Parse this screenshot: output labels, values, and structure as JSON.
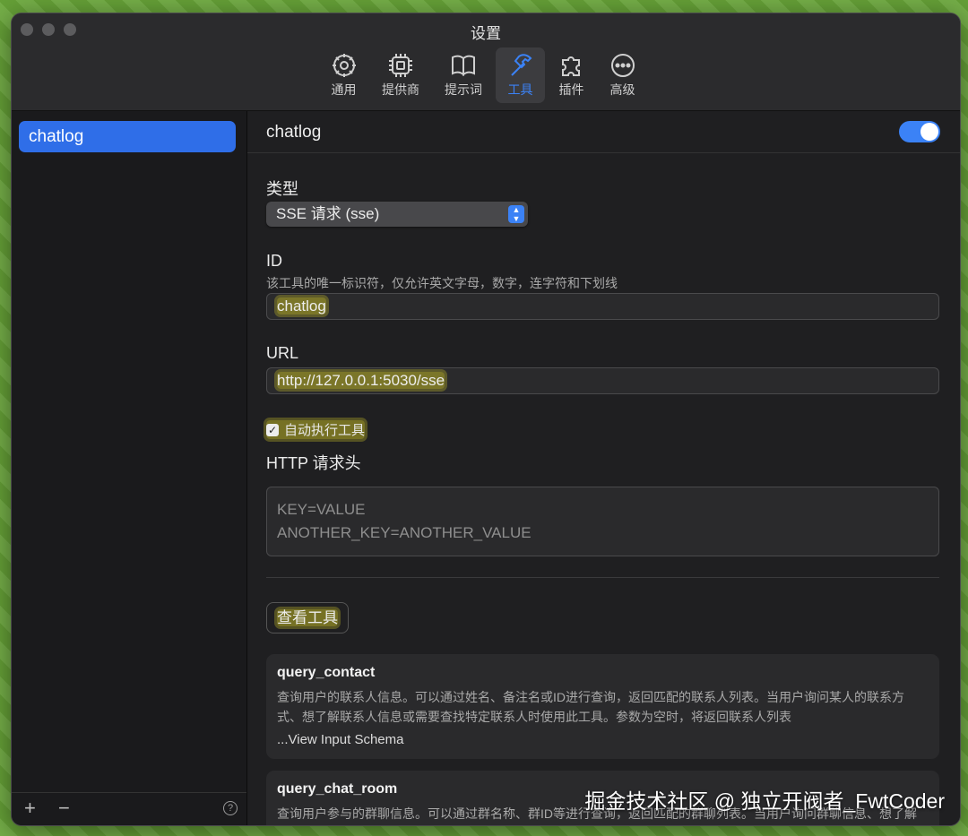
{
  "window": {
    "title": "设置"
  },
  "toolbar": {
    "items": [
      {
        "label": "通用",
        "icon": "gear-icon"
      },
      {
        "label": "提供商",
        "icon": "chip-icon"
      },
      {
        "label": "提示词",
        "icon": "book-icon"
      },
      {
        "label": "工具",
        "icon": "hammer-icon",
        "active": true
      },
      {
        "label": "插件",
        "icon": "puzzle-icon"
      },
      {
        "label": "高级",
        "icon": "ellipsis-circle-icon"
      }
    ]
  },
  "sidebar": {
    "items": [
      {
        "label": "chatlog",
        "selected": true
      }
    ],
    "add_label": "+",
    "remove_label": "−",
    "help_label": "?"
  },
  "main": {
    "title": "chatlog",
    "enabled": true,
    "type": {
      "label": "类型",
      "value": "SSE 请求 (sse)"
    },
    "id": {
      "label": "ID",
      "hint": "该工具的唯一标识符，仅允许英文字母，数字，连字符和下划线",
      "value": "chatlog"
    },
    "url": {
      "label": "URL",
      "value": "http://127.0.0.1:5030/sse"
    },
    "auto_execute": {
      "label": "自动执行工具",
      "checked": true
    },
    "headers": {
      "label": "HTTP 请求头",
      "placeholder_line1": "KEY=VALUE",
      "placeholder_line2": "ANOTHER_KEY=ANOTHER_VALUE"
    },
    "view_tools_label": "查看工具",
    "tools": [
      {
        "name": "query_contact",
        "description": "查询用户的联系人信息。可以通过姓名、备注名或ID进行查询，返回匹配的联系人列表。当用户询问某人的联系方式、想了解联系人信息或需要查找特定联系人时使用此工具。参数为空时，将返回联系人列表",
        "schema_link": "...View Input Schema"
      },
      {
        "name": "query_chat_room",
        "description": "查询用户参与的群聊信息。可以通过群名称、群ID等进行查询，返回匹配的群聊列表。当用户询问群聊信息、想了解某个群的详情或需要查找特定群聊时使用此工具。"
      }
    ]
  },
  "watermark": "掘金技术社区 @ 独立开阀者_FwtCoder",
  "colors": {
    "accent": "#3b82f6",
    "highlight": "#bfb428"
  }
}
